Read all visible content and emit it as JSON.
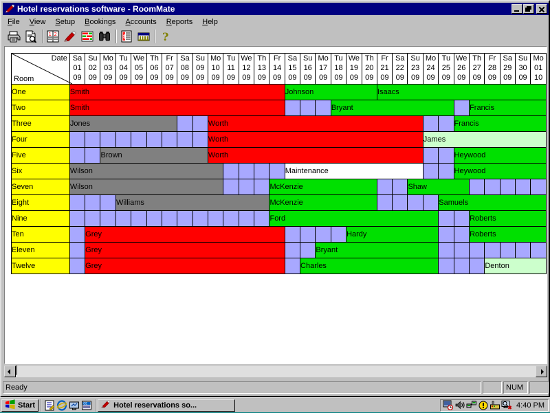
{
  "window": {
    "title": "Hotel reservations software - RoomMate",
    "icon": "pen-icon",
    "buttons": {
      "minimize": "minimize-button",
      "restore": "restore-button",
      "close": "close-button"
    }
  },
  "menubar": {
    "items": [
      {
        "label": "File",
        "accel": "F"
      },
      {
        "label": "View",
        "accel": "V"
      },
      {
        "label": "Setup",
        "accel": "S"
      },
      {
        "label": "Bookings",
        "accel": "B"
      },
      {
        "label": "Accounts",
        "accel": "A"
      },
      {
        "label": "Reports",
        "accel": "R"
      },
      {
        "label": "Help",
        "accel": "H"
      }
    ]
  },
  "toolbar": {
    "buttons": [
      {
        "name": "print-icon",
        "title": "Print"
      },
      {
        "name": "print-preview-icon",
        "title": "Print Preview"
      },
      {
        "name": "separator",
        "title": ""
      },
      {
        "name": "booking-list-icon",
        "title": "Bookings"
      },
      {
        "name": "pen-edit-icon",
        "title": "Edit booking"
      },
      {
        "name": "chart-bars-icon",
        "title": "Chart"
      },
      {
        "name": "binoculars-find-icon",
        "title": "Find"
      },
      {
        "name": "separator",
        "title": ""
      },
      {
        "name": "invoice-icon",
        "title": "Invoice"
      },
      {
        "name": "bank-icon",
        "title": "Accounts"
      },
      {
        "name": "separator",
        "title": ""
      },
      {
        "name": "help-icon",
        "title": "Help"
      }
    ]
  },
  "grid": {
    "corner": {
      "date_label": "Date",
      "room_label": "Room"
    },
    "columns": [
      {
        "dow": "Sa",
        "day": "01",
        "month": "09"
      },
      {
        "dow": "Su",
        "day": "02",
        "month": "09"
      },
      {
        "dow": "Mo",
        "day": "03",
        "month": "09"
      },
      {
        "dow": "Tu",
        "day": "04",
        "month": "09"
      },
      {
        "dow": "We",
        "day": "05",
        "month": "09"
      },
      {
        "dow": "Th",
        "day": "06",
        "month": "09"
      },
      {
        "dow": "Fr",
        "day": "07",
        "month": "09"
      },
      {
        "dow": "Sa",
        "day": "08",
        "month": "09"
      },
      {
        "dow": "Su",
        "day": "09",
        "month": "09"
      },
      {
        "dow": "Mo",
        "day": "10",
        "month": "09"
      },
      {
        "dow": "Tu",
        "day": "11",
        "month": "09"
      },
      {
        "dow": "We",
        "day": "12",
        "month": "09"
      },
      {
        "dow": "Th",
        "day": "13",
        "month": "09"
      },
      {
        "dow": "Fr",
        "day": "14",
        "month": "09"
      },
      {
        "dow": "Sa",
        "day": "15",
        "month": "09"
      },
      {
        "dow": "Su",
        "day": "16",
        "month": "09"
      },
      {
        "dow": "Mo",
        "day": "17",
        "month": "09"
      },
      {
        "dow": "Tu",
        "day": "18",
        "month": "09"
      },
      {
        "dow": "We",
        "day": "19",
        "month": "09"
      },
      {
        "dow": "Th",
        "day": "20",
        "month": "09"
      },
      {
        "dow": "Fr",
        "day": "21",
        "month": "09"
      },
      {
        "dow": "Sa",
        "day": "22",
        "month": "09"
      },
      {
        "dow": "Su",
        "day": "23",
        "month": "09"
      },
      {
        "dow": "Mo",
        "day": "24",
        "month": "09"
      },
      {
        "dow": "Tu",
        "day": "25",
        "month": "09"
      },
      {
        "dow": "We",
        "day": "26",
        "month": "09"
      },
      {
        "dow": "Th",
        "day": "27",
        "month": "09"
      },
      {
        "dow": "Fr",
        "day": "28",
        "month": "09"
      },
      {
        "dow": "Sa",
        "day": "29",
        "month": "09"
      },
      {
        "dow": "Su",
        "day": "30",
        "month": "09"
      },
      {
        "dow": "Mo",
        "day": "01",
        "month": "10"
      }
    ],
    "colors": {
      "empty": "#a8a8ff",
      "red": "#ff0000",
      "grey": "#808080",
      "green": "#00e000",
      "pale_green": "#ccffcc",
      "white": "#ffffff",
      "roomname_bg": "#ffff00"
    },
    "rows": [
      {
        "room": "One",
        "bookings": [
          {
            "name": "Smith",
            "start": 0,
            "span": 14,
            "color": "red"
          },
          {
            "name": "Johnson",
            "start": 14,
            "span": 6,
            "color": "green"
          },
          {
            "name": "Isaacs",
            "start": 20,
            "span": 11,
            "color": "green"
          }
        ]
      },
      {
        "room": "Two",
        "bookings": [
          {
            "name": "Smith",
            "start": 0,
            "span": 14,
            "color": "red"
          },
          {
            "name": "",
            "start": 14,
            "span": 3,
            "color": "empty"
          },
          {
            "name": "Bryant",
            "start": 17,
            "span": 8,
            "color": "green"
          },
          {
            "name": "",
            "start": 25,
            "span": 1,
            "color": "empty"
          },
          {
            "name": "Francis",
            "start": 26,
            "span": 5,
            "color": "green"
          }
        ]
      },
      {
        "room": "Three",
        "bookings": [
          {
            "name": "Jones",
            "start": 0,
            "span": 7,
            "color": "grey"
          },
          {
            "name": "",
            "start": 7,
            "span": 2,
            "color": "empty"
          },
          {
            "name": "Worth",
            "start": 9,
            "span": 14,
            "color": "red"
          },
          {
            "name": "",
            "start": 23,
            "span": 2,
            "color": "empty"
          },
          {
            "name": "Francis",
            "start": 25,
            "span": 6,
            "color": "green"
          }
        ]
      },
      {
        "room": "Four",
        "bookings": [
          {
            "name": "",
            "start": 0,
            "span": 9,
            "color": "empty"
          },
          {
            "name": "Worth",
            "start": 9,
            "span": 14,
            "color": "red"
          },
          {
            "name": "James",
            "start": 23,
            "span": 8,
            "color": "pale_green"
          }
        ]
      },
      {
        "room": "Five",
        "bookings": [
          {
            "name": "",
            "start": 0,
            "span": 2,
            "color": "empty"
          },
          {
            "name": "Brown",
            "start": 2,
            "span": 7,
            "color": "grey"
          },
          {
            "name": "Worth",
            "start": 9,
            "span": 14,
            "color": "red"
          },
          {
            "name": "",
            "start": 23,
            "span": 2,
            "color": "empty"
          },
          {
            "name": "Heywood",
            "start": 25,
            "span": 6,
            "color": "green"
          }
        ]
      },
      {
        "room": "Six",
        "bookings": [
          {
            "name": "Wilson",
            "start": 0,
            "span": 10,
            "color": "grey"
          },
          {
            "name": "",
            "start": 10,
            "span": 4,
            "color": "empty"
          },
          {
            "name": "Maintenance",
            "start": 14,
            "span": 9,
            "color": "white"
          },
          {
            "name": "",
            "start": 23,
            "span": 2,
            "color": "empty"
          },
          {
            "name": "Heywood",
            "start": 25,
            "span": 6,
            "color": "green"
          }
        ]
      },
      {
        "room": "Seven",
        "bookings": [
          {
            "name": "Wilson",
            "start": 0,
            "span": 10,
            "color": "grey"
          },
          {
            "name": "",
            "start": 10,
            "span": 3,
            "color": "empty"
          },
          {
            "name": "McKenzie",
            "start": 13,
            "span": 7,
            "color": "green"
          },
          {
            "name": "",
            "start": 20,
            "span": 2,
            "color": "empty"
          },
          {
            "name": "Shaw",
            "start": 22,
            "span": 4,
            "color": "green"
          },
          {
            "name": "",
            "start": 26,
            "span": 5,
            "color": "empty"
          }
        ]
      },
      {
        "room": "Eight",
        "bookings": [
          {
            "name": "",
            "start": 0,
            "span": 3,
            "color": "empty"
          },
          {
            "name": "Williams",
            "start": 3,
            "span": 10,
            "color": "grey"
          },
          {
            "name": "McKenzie",
            "start": 13,
            "span": 7,
            "color": "green"
          },
          {
            "name": "",
            "start": 20,
            "span": 4,
            "color": "empty"
          },
          {
            "name": "Samuels",
            "start": 24,
            "span": 7,
            "color": "green"
          }
        ]
      },
      {
        "room": "Nine",
        "bookings": [
          {
            "name": "",
            "start": 0,
            "span": 13,
            "color": "empty"
          },
          {
            "name": "Ford",
            "start": 13,
            "span": 11,
            "color": "green"
          },
          {
            "name": "",
            "start": 24,
            "span": 2,
            "color": "empty"
          },
          {
            "name": "Roberts",
            "start": 26,
            "span": 5,
            "color": "green"
          }
        ]
      },
      {
        "room": "Ten",
        "bookings": [
          {
            "name": "",
            "start": 0,
            "span": 1,
            "color": "empty"
          },
          {
            "name": "Grey",
            "start": 1,
            "span": 13,
            "color": "red"
          },
          {
            "name": "",
            "start": 14,
            "span": 4,
            "color": "empty"
          },
          {
            "name": "Hardy",
            "start": 18,
            "span": 6,
            "color": "green"
          },
          {
            "name": "",
            "start": 24,
            "span": 2,
            "color": "empty"
          },
          {
            "name": "Roberts",
            "start": 26,
            "span": 5,
            "color": "green"
          }
        ]
      },
      {
        "room": "Eleven",
        "bookings": [
          {
            "name": "",
            "start": 0,
            "span": 1,
            "color": "empty"
          },
          {
            "name": "Grey",
            "start": 1,
            "span": 13,
            "color": "red"
          },
          {
            "name": "",
            "start": 14,
            "span": 2,
            "color": "empty"
          },
          {
            "name": "Bryant",
            "start": 16,
            "span": 8,
            "color": "green"
          },
          {
            "name": "",
            "start": 24,
            "span": 7,
            "color": "empty"
          }
        ]
      },
      {
        "room": "Twelve",
        "bookings": [
          {
            "name": "",
            "start": 0,
            "span": 1,
            "color": "empty"
          },
          {
            "name": "Grey",
            "start": 1,
            "span": 13,
            "color": "red"
          },
          {
            "name": "",
            "start": 14,
            "span": 1,
            "color": "empty"
          },
          {
            "name": "Charles",
            "start": 15,
            "span": 9,
            "color": "green"
          },
          {
            "name": "",
            "start": 24,
            "span": 3,
            "color": "empty"
          },
          {
            "name": "Denton",
            "start": 27,
            "span": 4,
            "color": "pale_green"
          }
        ]
      }
    ]
  },
  "statusbar": {
    "message": "Ready",
    "num_indicator": "NUM"
  },
  "taskbar": {
    "start_label": "Start",
    "quick_launch": [
      {
        "name": "notepad-icon"
      },
      {
        "name": "internet-explorer-icon"
      },
      {
        "name": "show-desktop-icon"
      },
      {
        "name": "outlook-express-icon"
      }
    ],
    "tasks": [
      {
        "label": "Hotel reservations so...",
        "icon": "pen-icon",
        "active": true
      }
    ],
    "tray": {
      "icons": [
        {
          "name": "scheduled-tasks-icon"
        },
        {
          "name": "volume-icon"
        },
        {
          "name": "network-icon"
        },
        {
          "name": "warning-icon"
        },
        {
          "name": "modem-icon"
        },
        {
          "name": "display-error-icon"
        }
      ],
      "clock": "4:40 PM"
    }
  }
}
